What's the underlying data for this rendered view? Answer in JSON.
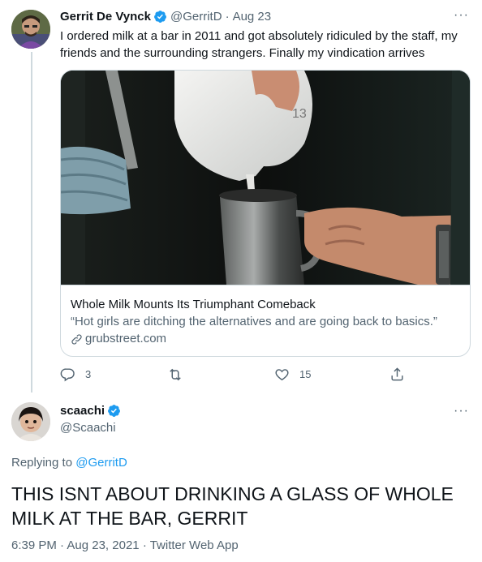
{
  "tweet1": {
    "display_name": "Gerrit De Vynck",
    "handle": "@GerritD",
    "separator": "·",
    "date": "Aug 23",
    "more": "···",
    "text": "I ordered milk at a bar in 2011 and got absolutely ridiculed by the staff, my friends and the surrounding strangers. Finally my vindication arrives",
    "verified": true,
    "card": {
      "title": "Whole Milk Mounts Its Triumphant Comeback",
      "description": "“Hot girls are ditching the alternatives and are going back to basics.”",
      "domain": "grubstreet.com",
      "image_icon": "milk-pour-photo"
    },
    "actions": {
      "reply_count": "3",
      "retweet_count": "",
      "like_count": "15",
      "share_count": ""
    }
  },
  "tweet2": {
    "display_name": "scaachi",
    "handle": "@Scaachi",
    "more": "···",
    "verified": true,
    "replying_prefix": "Replying to",
    "replying_to": "@GerritD",
    "text": "THIS ISNT ABOUT DRINKING A GLASS OF WHOLE MILK AT THE BAR, GERRIT",
    "time": "6:39 PM",
    "sep1": "·",
    "date": "Aug 23, 2021",
    "sep2": "·",
    "app": "Twitter Web App"
  },
  "colors": {
    "accent": "#1d9bf0",
    "text": "#0f1419",
    "secondary": "#536471",
    "border": "#cfd9de"
  }
}
